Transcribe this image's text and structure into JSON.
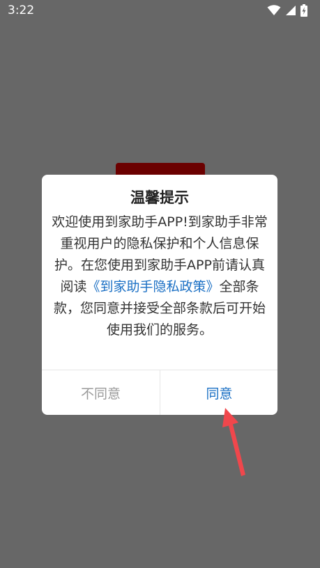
{
  "status_bar": {
    "time": "3:22",
    "icons": [
      "wifi-icon",
      "signal-icon",
      "battery-charging-icon"
    ]
  },
  "dialog": {
    "title": "温馨提示",
    "message_before_link": "欢迎使用到家助手APP!到家助手非常重视用户的隐私保护和个人信息保护。在您使用到家助手APP前请认真阅读",
    "policy_link": "《到家助手隐私政策》",
    "message_after_link": "全部条款，您同意并接受全部条款后可开始使用我们的服务。",
    "disagree_label": "不同意",
    "agree_label": "同意"
  },
  "colors": {
    "overlay": "#676767",
    "link": "#1a6fc4",
    "disagree_text": "#9a9a9a",
    "annotation_arrow": "#f0474c",
    "background_button": "#6b0000"
  }
}
